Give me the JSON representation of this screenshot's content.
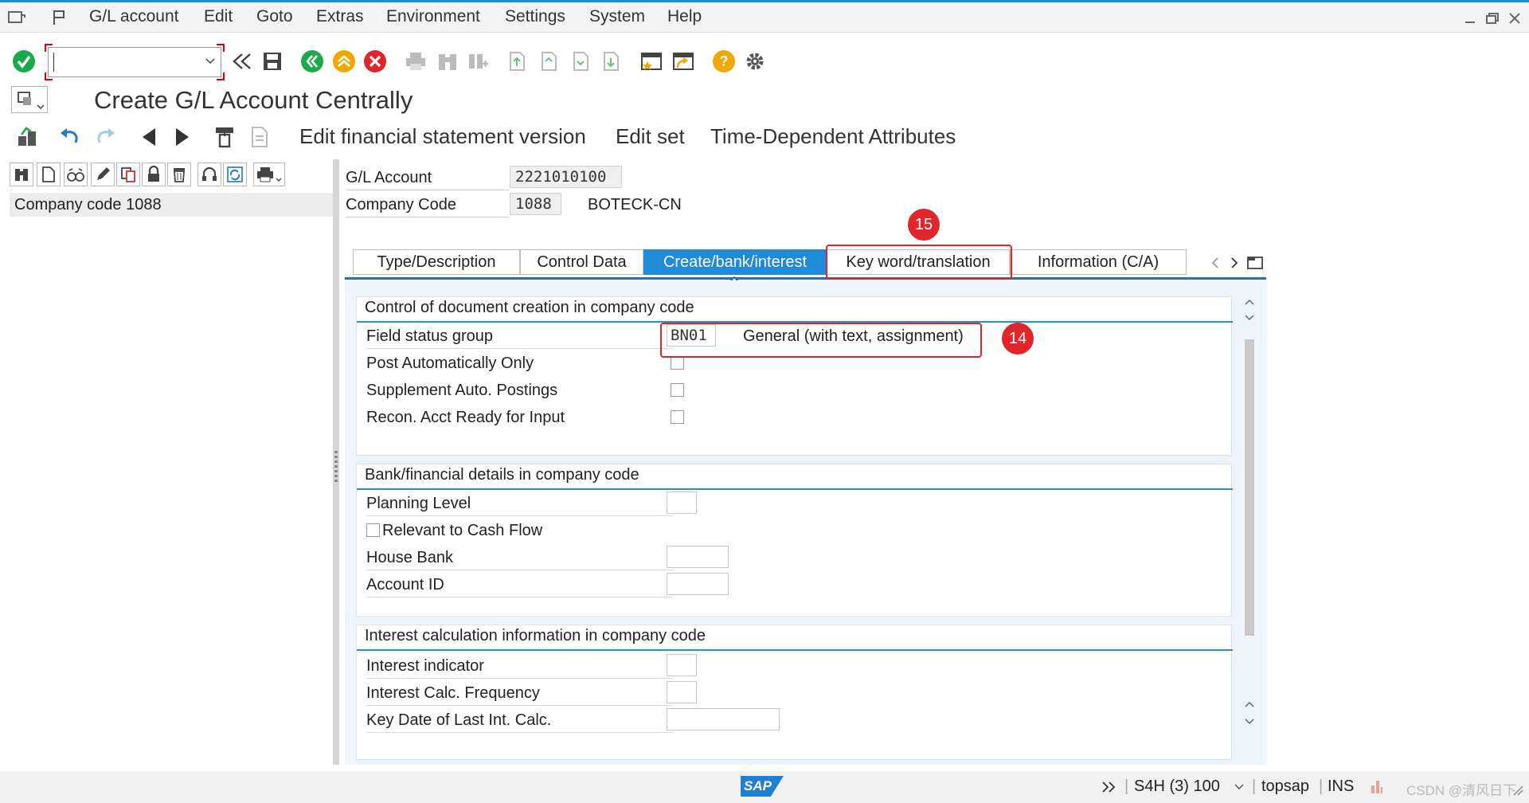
{
  "menubar": {
    "items": [
      "G/L account",
      "Edit",
      "Goto",
      "Extras",
      "Environment",
      "Settings",
      "System",
      "Help"
    ]
  },
  "toolbar": {
    "command_value": "",
    "icons": [
      "enter-icon",
      "save-icon",
      "back-icon",
      "exit-icon",
      "cancel-icon",
      "print-icon",
      "find-icon",
      "help-icon",
      "settings-icon"
    ]
  },
  "title": "Create G/L Account Centrally",
  "app_toolbar": {
    "items": [
      "Edit financial statement version",
      "Edit set",
      "Time-Dependent Attributes"
    ]
  },
  "tree": {
    "row": "Company code 1088"
  },
  "header": {
    "gl_account_label": "G/L Account",
    "gl_account_value": "2221010100",
    "company_code_label": "Company Code",
    "company_code_value": "1088",
    "company_name": "BOTECK-CN"
  },
  "tabs": [
    {
      "label": "Type/Description",
      "active": false
    },
    {
      "label": "Control Data",
      "active": false
    },
    {
      "label": "Create/bank/interest",
      "active": true
    },
    {
      "label": "Key word/translation",
      "active": false
    },
    {
      "label": "Information (C/A)",
      "active": false
    }
  ],
  "groups": {
    "doc_creation": {
      "title": "Control of document creation in company code",
      "field_status_group_label": "Field status group",
      "field_status_group_value": "BN01",
      "field_status_group_desc": "General (with text, assignment)",
      "post_auto_label": "Post Automatically Only",
      "post_auto_checked": false,
      "supplement_label": "Supplement Auto. Postings",
      "supplement_checked": false,
      "recon_label": "Recon. Acct Ready for Input",
      "recon_checked": false
    },
    "bank": {
      "title": "Bank/financial details in company code",
      "planning_level_label": "Planning Level",
      "planning_level_value": "",
      "cash_flow_label": "Relevant to Cash Flow",
      "cash_flow_checked": false,
      "house_bank_label": "House Bank",
      "house_bank_value": "",
      "account_id_label": "Account ID",
      "account_id_value": ""
    },
    "interest": {
      "title": "Interest calculation information in company code",
      "indicator_label": "Interest indicator",
      "indicator_value": "",
      "frequency_label": "Interest Calc. Frequency",
      "frequency_value": "",
      "key_date_label": "Key Date of Last Int. Calc.",
      "key_date_value": ""
    }
  },
  "annotations": {
    "badge_15": "15",
    "badge_14": "14"
  },
  "statusbar": {
    "logo": "SAP",
    "system": "S4H (3) 100",
    "host": "topsap",
    "mode": "INS",
    "watermark": "CSDN @清风日下"
  },
  "colors": {
    "accent": "#1f8ad8",
    "annotation": "#e0262a"
  }
}
